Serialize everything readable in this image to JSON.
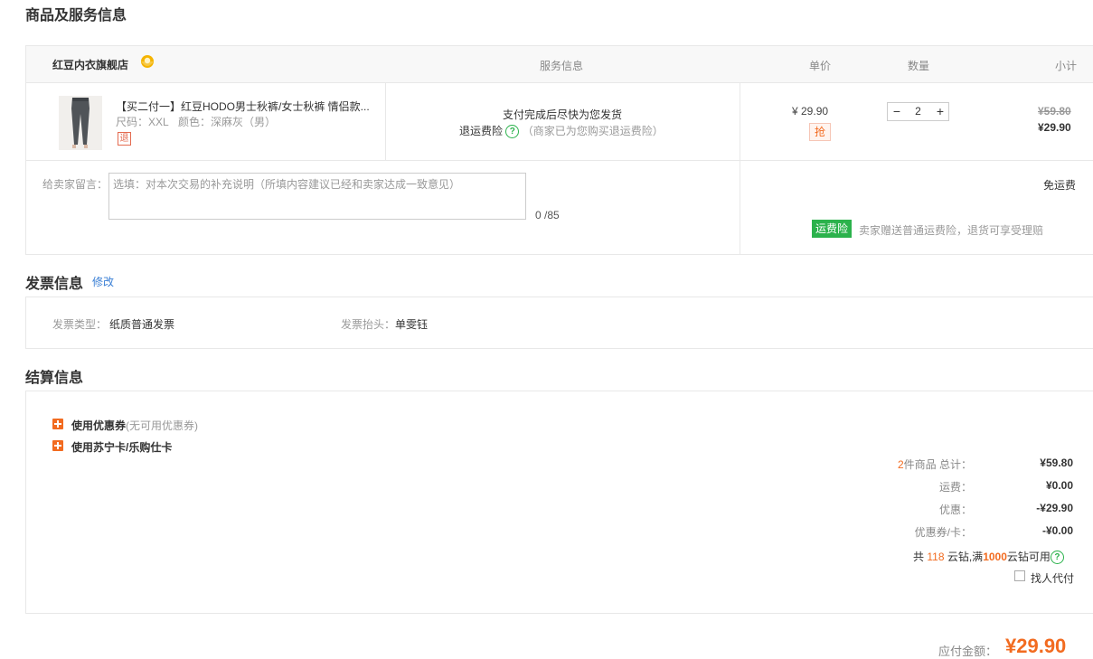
{
  "sections": {
    "goods_title": "商品及服务信息",
    "invoice_title": "发票信息",
    "invoice_edit": "修改",
    "settle_title": "结算信息"
  },
  "table_header": {
    "store_name": "红豆内衣旗舰店",
    "service": "服务信息",
    "unit_price": "单价",
    "quantity": "数量",
    "subtotal": "小计"
  },
  "product": {
    "title": "【买二付一】红豆HODO男士秋裤/女士秋裤 情侣款...",
    "size": "尺码：XXL",
    "color": "颜色：深麻灰（男）",
    "return_badge": "退",
    "service_line1": "支付完成后尽快为您发货",
    "service_line2_label": "退运费险",
    "service_line2_note": "（商家已为您购买退运费险）",
    "price": "¥ 29.90",
    "promo_badge": "抢",
    "qty": "2",
    "subtotal_original": "¥59.80",
    "subtotal": "¥29.90"
  },
  "message": {
    "label": "给卖家留言：",
    "placeholder": "选填：对本次交易的补充说明（所填内容建议已经和卖家达成一致意见）",
    "counter": "0 /85",
    "shipping": "免运费",
    "insurance_badge": "运费险",
    "insurance_text": "卖家赠送普通运费险，退货可享受理赔"
  },
  "invoice": {
    "type_label": "发票类型：",
    "type_value": "纸质普通发票",
    "header_label": "发票抬头：",
    "header_value": "单雯钰"
  },
  "settle": {
    "coupon_label": "使用优惠券",
    "coupon_note": "(无可用优惠券)",
    "card_label": "使用苏宁卡/乐购仕卡",
    "count": "2",
    "count_suffix": "件商品 总计：",
    "total": "¥59.80",
    "shipping_label": "运费：",
    "shipping_value": "¥0.00",
    "discount_label": "优惠：",
    "discount_value": "-¥29.90",
    "coupon_card_label": "优惠券/卡：",
    "coupon_card_value": "-¥0.00",
    "yunzuan_prefix": "共",
    "yunzuan_count": "118",
    "yunzuan_mid": "云钻,满",
    "yunzuan_threshold": "1000",
    "yunzuan_suffix": "云钻可用",
    "proxy_pay": "找人代付",
    "payable_label": "应付金额：",
    "payable_value": "¥29.90"
  }
}
